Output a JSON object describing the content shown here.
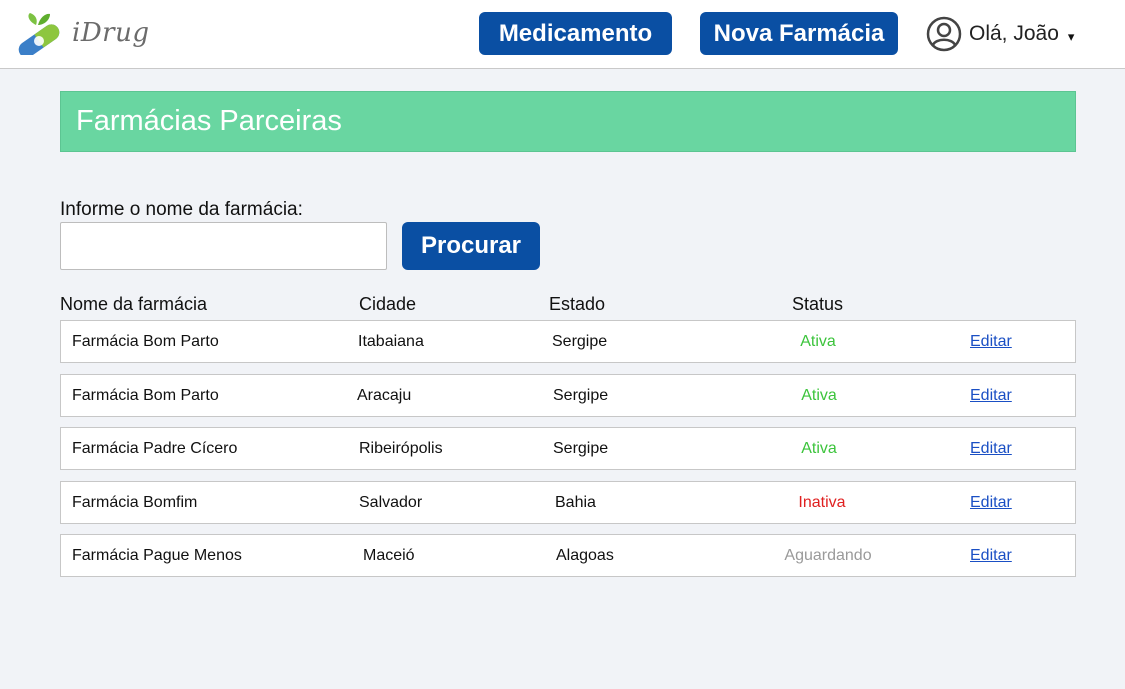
{
  "header": {
    "logo_text": "iDrug",
    "nav": [
      {
        "label": "Medicamento"
      },
      {
        "label": "Nova Farmácia"
      }
    ],
    "user_greeting": "Olá, João",
    "user_caret": "▾"
  },
  "banner": {
    "title": "Farmácias Parceiras"
  },
  "search": {
    "label": "Informe o nome da farmácia:",
    "value": "",
    "placeholder": "",
    "button_label": "Procurar"
  },
  "table": {
    "columns": [
      "Nome da farmácia",
      "Cidade",
      "Estado",
      "Status"
    ],
    "rows": [
      {
        "name": "Farmácia Bom Parto",
        "city": "Itabaiana",
        "state": "Sergipe",
        "status": "Ativa",
        "action": "Editar"
      },
      {
        "name": "Farmácia Bom Parto",
        "city": "Aracaju",
        "state": "Sergipe",
        "status": "Ativa",
        "action": "Editar"
      },
      {
        "name": "Farmácia Padre Cícero",
        "city": "Ribeirópolis",
        "state": "Sergipe",
        "status": "Ativa",
        "action": "Editar"
      },
      {
        "name": "Farmácia Bomfim",
        "city": "Salvador",
        "state": "Bahia",
        "status": "Inativa",
        "action": "Editar"
      },
      {
        "name": "Farmácia Pague Menos",
        "city": "Maceió",
        "state": "Alagoas",
        "status": "Aguardando",
        "action": "Editar"
      }
    ]
  },
  "colors": {
    "brand_blue": "#0a4fa3",
    "banner_green": "#69d6a1",
    "status_active": "#3cc43c",
    "status_inactive": "#e02020",
    "status_pending": "#9a9a9a",
    "link": "#1a4fc4"
  },
  "icons": {
    "logo": "pill-capsule-leaf-icon",
    "user": "user-avatar-icon"
  }
}
